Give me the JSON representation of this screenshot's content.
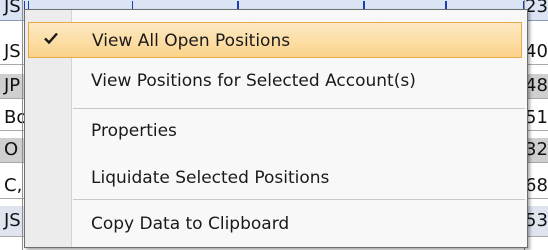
{
  "grid": {
    "rows": [
      {
        "left": "JS",
        "right": "23"
      },
      {
        "left": "JS",
        "right": "40"
      },
      {
        "left": "JP",
        "right": "48"
      },
      {
        "left": "Bo",
        "right": "51"
      },
      {
        "left": "O",
        "right": "32"
      },
      {
        "left": "C,",
        "right": "68"
      },
      {
        "left": "JS",
        "right": "53"
      }
    ]
  },
  "menu": {
    "items": [
      {
        "label": "View All Open Positions",
        "checked": true
      },
      {
        "label": "View Positions for Selected Account(s)"
      },
      {
        "label": "Properties"
      },
      {
        "label": "Liquidate Selected Positions"
      },
      {
        "label": "Copy Data to Clipboard"
      }
    ]
  },
  "colors": {
    "selected_top": "#fde9c4",
    "selected_bottom": "#fbd38a",
    "selected_border": "#e3a94a"
  },
  "icons": {
    "check": "checkmark-icon"
  }
}
